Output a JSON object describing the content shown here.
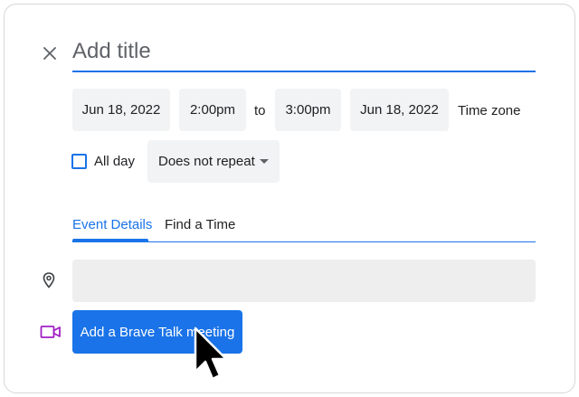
{
  "title_field": {
    "placeholder": "Add title"
  },
  "datetime": {
    "start_date": "Jun 18, 2022",
    "start_time": "2:00pm",
    "separator": "to",
    "end_time": "3:00pm",
    "end_date": "Jun 18, 2022",
    "timezone_label": "Time zone"
  },
  "all_day": {
    "label": "All day",
    "checked": false
  },
  "repeat": {
    "selected": "Does not repeat"
  },
  "tabs": [
    {
      "label": "Event Details",
      "active": true
    },
    {
      "label": "Find a Time",
      "active": false
    }
  ],
  "location": {
    "value": ""
  },
  "video": {
    "button_label": "Add a Brave Talk meeting"
  },
  "colors": {
    "accent": "#1a73e8",
    "chip_bg": "#f1f3f4",
    "video_icon": "#a01fc5",
    "text": "#202124"
  },
  "icons": {
    "close": "close-icon",
    "location": "location-pin-icon",
    "video": "video-camera-icon",
    "cursor": "mouse-pointer-icon"
  }
}
